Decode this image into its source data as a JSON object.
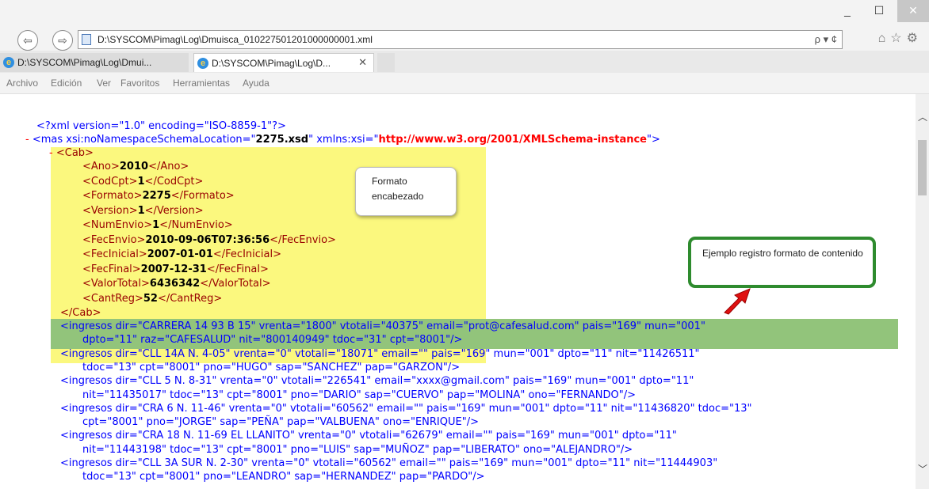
{
  "window": {
    "min_label": "_",
    "max_label": "☐",
    "close_label": "✕"
  },
  "nav": {
    "back": "⇦",
    "forward": "⇨"
  },
  "address": {
    "url": "D:\\SYSCOM\\Pimag\\Log\\Dmuisca_010227501201000000001.xml",
    "tools": "ρ ▾ ¢"
  },
  "toolbar_icons": "⌂☆⚙",
  "tabs": [
    {
      "title": "D:\\SYSCOM\\Pimag\\Log\\Dmui...",
      "active": false
    },
    {
      "title": "D:\\SYSCOM\\Pimag\\Log\\D...",
      "active": true,
      "close": "✕"
    }
  ],
  "menu": [
    "Archivo",
    "Edición",
    "Ver",
    "Favoritos",
    "Herramientas",
    "Ayuda"
  ],
  "xml": {
    "decl": "<?xml version=\"1.0\" encoding=\"ISO-8859-1\"?>",
    "root_open_a": "<mas xsi:noNamespaceSchemaLocation=\"",
    "root_schema": "2275.xsd",
    "root_mid": "\" xmlns:xsi=\"",
    "root_ns": "http://www.w3.org/2001/XMLSchema-instance",
    "root_close": "\">",
    "minus": "-",
    "cab_open": "<Cab>",
    "cab_close": "</Cab>",
    "cab_fields": [
      {
        "open": "<Ano>",
        "value": "2010",
        "close": "</Ano>"
      },
      {
        "open": "<CodCpt>",
        "value": "1",
        "close": "</CodCpt>"
      },
      {
        "open": "<Formato>",
        "value": "2275",
        "close": "</Formato>"
      },
      {
        "open": "<Version>",
        "value": "1",
        "close": "</Version>"
      },
      {
        "open": "<NumEnvio>",
        "value": "1",
        "close": "</NumEnvio>"
      },
      {
        "open": "<FecEnvio>",
        "value": "2010-09-06T07:36:56",
        "close": "</FecEnvio>"
      },
      {
        "open": "<FecInicial>",
        "value": "2007-01-01",
        "close": "</FecInicial>"
      },
      {
        "open": "<FecFinal>",
        "value": "2007-12-31",
        "close": "</FecFinal>"
      },
      {
        "open": "<ValorTotal>",
        "value": "6436342",
        "close": "</ValorTotal>"
      },
      {
        "open": "<CantReg>",
        "value": "52",
        "close": "</CantReg>"
      }
    ],
    "ingresos_lines": [
      "<ingresos dir=\"CARRERA 14 93 B 15\" vrenta=\"1800\" vtotali=\"40375\" email=\"prot@cafesalud.com\" pais=\"169\" mun=\"001\"",
      "dpto=\"11\" raz=\"CAFESALUD\" nit=\"800140949\" tdoc=\"31\" cpt=\"8001\"/>",
      "<ingresos dir=\"CLL 14A N. 4-05\" vrenta=\"0\" vtotali=\"18071\" email=\"\" pais=\"169\" mun=\"001\" dpto=\"11\" nit=\"11426511\"",
      "tdoc=\"13\" cpt=\"8001\" pno=\"HUGO\" sap=\"SANCHEZ\" pap=\"GARZON\"/>",
      "<ingresos dir=\"CLL 5 N. 8-31\" vrenta=\"0\" vtotali=\"226541\" email=\"xxxx@gmail.com\" pais=\"169\" mun=\"001\" dpto=\"11\"",
      "nit=\"11435017\" tdoc=\"13\" cpt=\"8001\" pno=\"DARIO\" sap=\"CUERVO\" pap=\"MOLINA\" ono=\"FERNANDO\"/>",
      "<ingresos dir=\"CRA 6 N. 11-46\" vrenta=\"0\" vtotali=\"60562\" email=\"\" pais=\"169\" mun=\"001\" dpto=\"11\" nit=\"11436820\" tdoc=\"13\"",
      "cpt=\"8001\" pno=\"JORGE\" sap=\"PEÑA\" pap=\"VALBUENA\" ono=\"ENRIQUE\"/>",
      "<ingresos dir=\"CRA 18 N. 11-69 EL LLANITO\" vrenta=\"0\" vtotali=\"62679\" email=\"\" pais=\"169\" mun=\"001\" dpto=\"11\"",
      "nit=\"11443198\" tdoc=\"13\" cpt=\"8001\" pno=\"LUIS\" sap=\"MUÑOZ\" pap=\"LIBERATO\" ono=\"ALEJANDRO\"/>",
      "<ingresos dir=\"CLL 3A SUR N. 2-30\" vrenta=\"0\" vtotali=\"60562\" email=\"\" pais=\"169\" mun=\"001\" dpto=\"11\" nit=\"11444903\"",
      "tdoc=\"13\" cpt=\"8001\" pno=\"LEANDRO\" sap=\"HERNANDEZ\" pap=\"PARDO\"/>"
    ]
  },
  "callouts": {
    "header": "Formato encabezado",
    "content": "Ejemplo registro formato de contenido"
  }
}
